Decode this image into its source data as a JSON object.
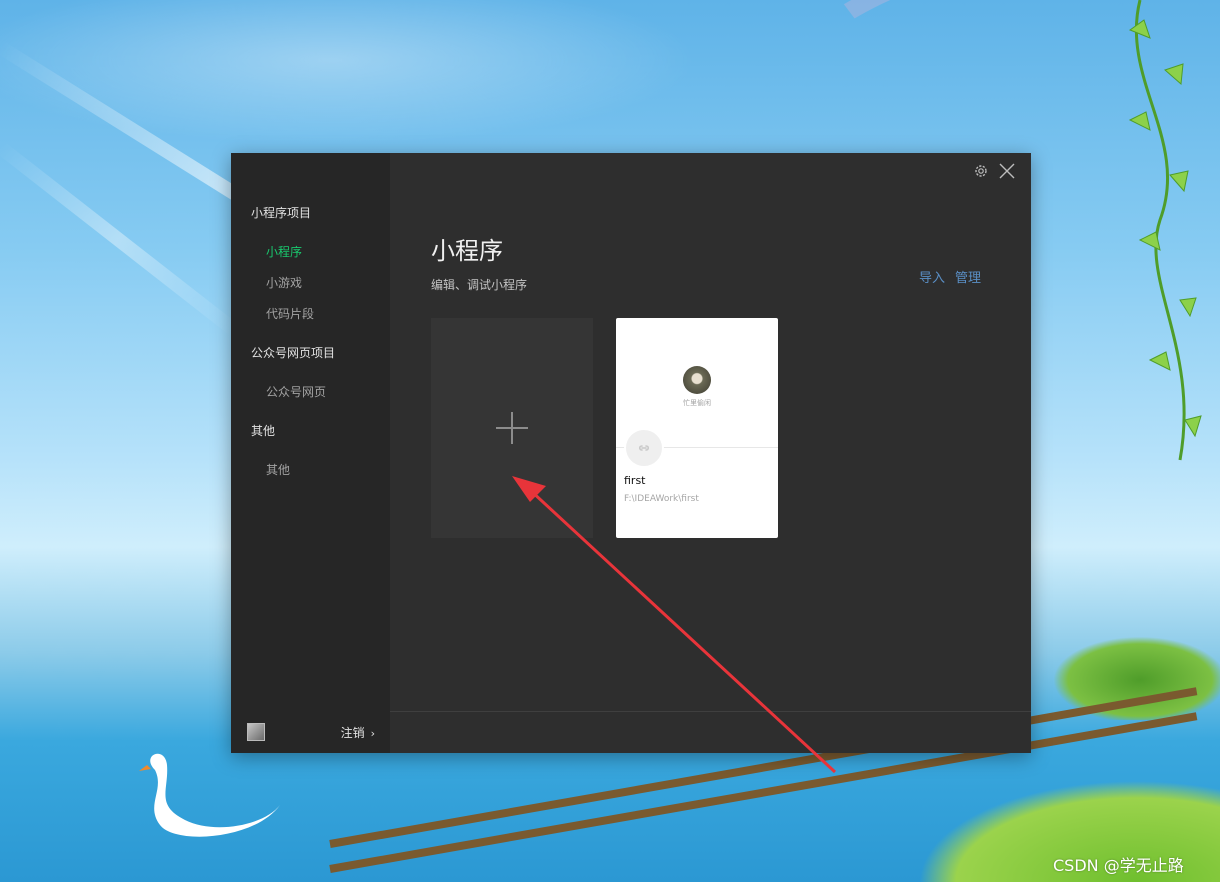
{
  "sidebar": {
    "sections": [
      {
        "title": "小程序项目",
        "items": [
          "小程序",
          "小游戏",
          "代码片段"
        ]
      },
      {
        "title": "公众号网页项目",
        "items": [
          "公众号网页"
        ]
      },
      {
        "title": "其他",
        "items": [
          "其他"
        ]
      }
    ],
    "active_item": "小程序",
    "logout_label": "注销",
    "logout_chevron": "›"
  },
  "main": {
    "title": "小程序",
    "subtitle": "编辑、调试小程序",
    "actions": {
      "import_label": "导入",
      "manage_label": "管理"
    },
    "projects": [
      {
        "owner": "忙里偷闲",
        "name": "first",
        "path": "F:\\IDEAWork\\first"
      }
    ]
  },
  "colors": {
    "accent": "#19c86e",
    "link": "#5a8fc6",
    "annotation_arrow": "#e8343a"
  },
  "icons": {
    "settings": "gear-icon",
    "close": "close-icon",
    "add": "plus-icon",
    "project_logo": "mini-program-link-icon"
  },
  "watermark": "CSDN @学无止路"
}
